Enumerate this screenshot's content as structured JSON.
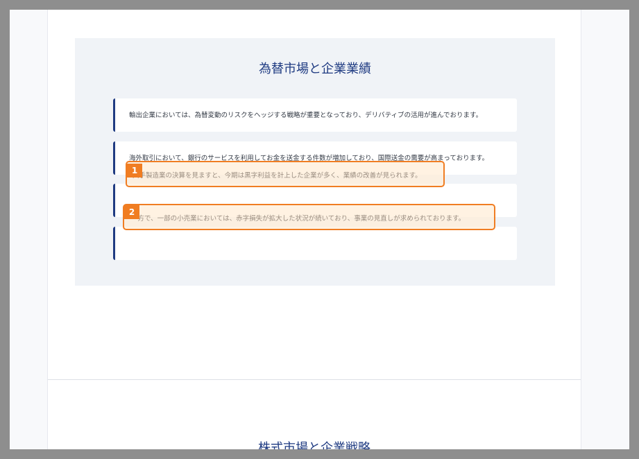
{
  "section1": {
    "title": "為替市場と企業業績",
    "cards": [
      "輸出企業においては、為替変動のリスクをヘッジする戦略が重要となっており、デリバティブの活用が進んでおります。",
      "海外取引において、銀行のサービスを利用してお金を送金する件数が増加しており、国際送金の需要が高まっております。",
      "大手製造業の決算を見ますと、今期は黒字利益を計上した企業が多く、業績の改善が見られます。",
      "一方で、一部の小売業においては、赤字損失が拡大した状況が続いており、事業の見直しが求められております。"
    ]
  },
  "highlights": [
    {
      "label": "1",
      "text": "大手製造業の決算を見ますと、今期は黒字利益を計上した企業が多く、業績の改善が見られます。"
    },
    {
      "label": "2",
      "text": "一方で、一部の小売業においては、赤字損失が拡大した状況が続いており、事業の見直しが求められております。"
    }
  ],
  "section2": {
    "title": "株式市場と企業戦略"
  },
  "colors": {
    "accent": "#1f3b82",
    "highlight": "#f07d22"
  }
}
